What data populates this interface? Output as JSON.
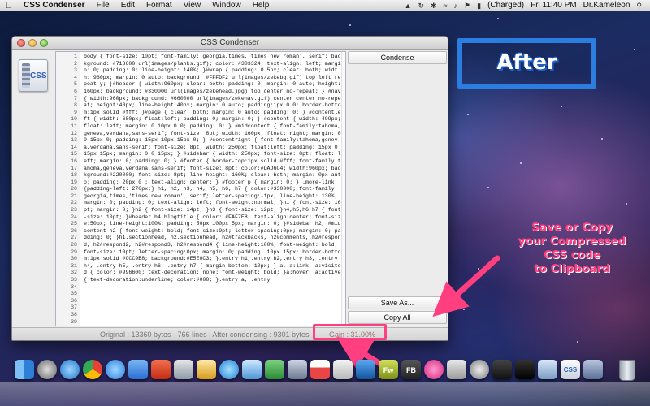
{
  "menubar": {
    "app_name": "CSS Condenser",
    "menus": [
      "File",
      "Edit",
      "Format",
      "View",
      "Window",
      "Help"
    ],
    "battery": "(Charged)",
    "clock": "Fri 11:40 PM",
    "user": "Dr.Kameleon"
  },
  "window": {
    "title": "CSS Condenser",
    "icon_text": "CSS",
    "line_numbers": "1\n2\n3\n4\n5\n6\n7\n8\n9\n10\n11\n12\n13\n14\n15\n16\n17\n18\n19\n20\n21\n22\n23\n24\n25\n26\n27\n28\n29\n30\n31\n32\n33\n34\n35\n36\n37\n38\n39",
    "code": "body { font-size: 10pt; font-family: georgia,times,'times new roman', serif; background: #713600 url(images/planks.gif); color: #303324; text-align: left; margin: 0; padding: 0; line-height: 140%; }#wrap { padding: 0 5px; clear: both; width: 960px; margin: 0 auto; background: #FFFDF2 url(images/zekebg.gif) top left repeat-y; }#header { width:960px; clear: both; padding: 0; margin: 0 auto; height:160px; background: #330000 url(images/zekehead.jpg) top center no-repeat; } #nav { width:960px; background: #660000 url(images/zekenav.gif) center center no-repeat; height:40px; line-height:40px; margin: 0 auto; padding:1px 0 0; border-bottom:1px solid #fff; }#page { clear: both; margin: 0 auto; padding: 0; } #contentleft { width: 680px; float:left; padding: 0; margin: 0; } #content { width: 499px; float: left; margin: 0 10px 0 0; padding: 0; } #midcontent { font-family:tahoma,geneva,verdana,sans-serif; font-size: 8pt; width: 160px; float: right; margin: 0 0 15px 0; padding: 15px 10px 15px 0; } #contentright { font-family:tahoma,geneva,verdana,sans-serif; font-size: 8pt; width: 250px; float:left; padding: 15px 0 15px 15px; margin: 0 0 15px; } #sidebar { width: 250px; font-size: 8pt; float: left; margin: 0; padding: 0; } #footer { border-top:1px solid #fff; font-family:tahoma,geneva,verdana,sans-serif; font-size: 8pt; color:#DAD6C4; width:960px; background:#220000; font-size: 8pt; line-height: 160%; clear: both; margin: 0px auto; padding: 20px 0 ; text-align: center; } #footer p { margin: 0; } .more-link {padding-left: 270px;} h1, h2, h3, h4, h5, h6, h7 { color:#330000; font-family: georgia,times,'times new roman', serif; letter-spacing:-1px; line-height: 130%; margin: 0; padding: 0; text-align: left; font-weight:normal; }h1 { font-size: 16pt; margin: 0; }h2 { font-size: 14pt; }h3 { font-size: 12pt; }h4,h5,h6,h7 { font-size: 10pt; }#header h4.blogtitle { color: #FAF7E8; text-align:center; font-size:50px; line-height:100%; padding: 50px 100px 5px; margin: 0; }#sidebar h2, #midcontent h2 { font-weight: bold; font-size:9pt; letter-spacing:0px; margin: 0; padding: 0; }h1.sectionhead, h2.sectionhead, h2#trackbacks, h2#comments, h2#respond, h2#respond2, h2#respond3, h2#respond4 { line-height:100%; font-weight: bold; font-size: 10pt; letter-spacing:0px; margin: 0; padding: 10px 15px; border-bottom:1px solid #CCC9B8; background:#E5E0C3; }.entry h1,.entry h2,.entry h3, .entry h4, .entry h5, .entry h6, .entry h7 { margin-bottom: 10px; } a, a:link, a:visited { color: #996600; text-decoration: none; font-weight: bold; }a:hover, a:active { text-decoration:underline; color:#000; }.entry a, .entry",
    "buttons": {
      "condense": "Condense",
      "save_as": "Save As...",
      "copy_all": "Copy All"
    },
    "status": "Original : 13360 bytes - 766 lines | After condensing : 9301 bytes",
    "gain": "Gain : 31.00%"
  },
  "annotations": {
    "after_label": "After",
    "note_lines": [
      "Save or Copy",
      "your Compressed",
      "CSS code",
      "to Clipboard"
    ],
    "color": "#ff3f7f",
    "after_box_color": "#2b7de0"
  },
  "dock": {
    "fireworks_label": "Fw",
    "fb_label": "FB",
    "css_label": "CSS"
  }
}
